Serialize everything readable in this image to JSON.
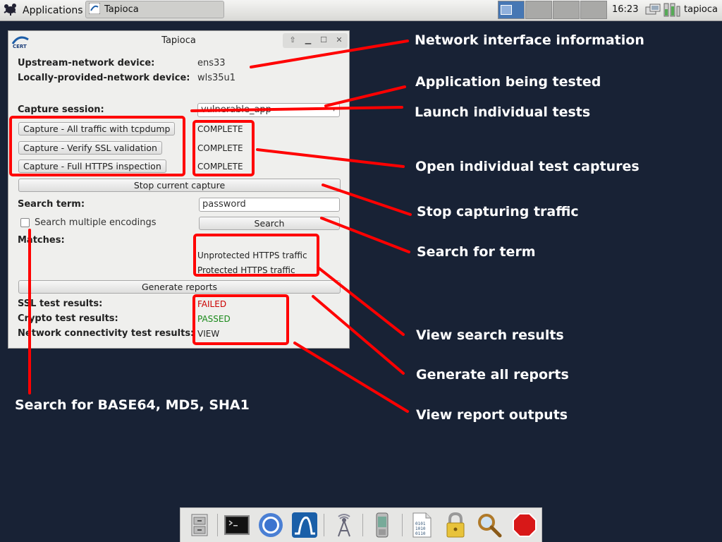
{
  "panel": {
    "apps_label": "Applications",
    "task_label": "Tapioca",
    "clock": "16:23",
    "user": "tapioca"
  },
  "window": {
    "title": "Tapioca",
    "upstream_label": "Upstream-network device:",
    "upstream_value": "ens33",
    "local_label": "Locally-provided-network device:",
    "local_value": "wls35u1",
    "session_label": "Capture session:",
    "session_value": "vulnerable_app",
    "captures": [
      {
        "button": "Capture - All traffic with tcpdump",
        "status": "COMPLETE"
      },
      {
        "button": "Capture - Verify SSL validation",
        "status": "COMPLETE"
      },
      {
        "button": "Capture - Full HTTPS inspection",
        "status": "COMPLETE"
      }
    ],
    "stop_button": "Stop current capture",
    "search_label": "Search term:",
    "search_value": "password",
    "multi_enc_label": "Search multiple encodings",
    "search_button": "Search",
    "matches_label": "Matches:",
    "matches": [
      "Unprotected HTTPS traffic",
      "Protected HTTPS traffic"
    ],
    "generate_button": "Generate reports",
    "results": [
      {
        "label": "SSL test results:",
        "value": "FAILED",
        "color": "#cc0000"
      },
      {
        "label": "Crypto test results:",
        "value": "PASSED",
        "color": "#1a8a1a"
      },
      {
        "label": "Network connectivity test results:",
        "value": "VIEW",
        "color": "#333333"
      }
    ]
  },
  "annotations": {
    "network_info": "Network interface information",
    "app_tested": "Application being tested",
    "launch_tests": "Launch individual tests",
    "open_captures": "Open individual test captures",
    "stop_capture": "Stop capturing traffic",
    "search_term": "Search for term",
    "view_search": "View search results",
    "generate_reports": "Generate all reports",
    "view_reports": "View report outputs",
    "search_encodings": "Search for BASE64, MD5, SHA1"
  },
  "colors": {
    "desktop": "#182235",
    "annotation": "#ff0000",
    "workspace_active": "#4677b4"
  },
  "dock_icons": [
    "file-cabinet-icon",
    "terminal-icon",
    "chromium-icon",
    "wireshark-icon",
    "wifi-tower-icon",
    "phone-icon",
    "binary-file-icon",
    "lock-icon",
    "magnifier-icon",
    "stop-sign-icon"
  ]
}
